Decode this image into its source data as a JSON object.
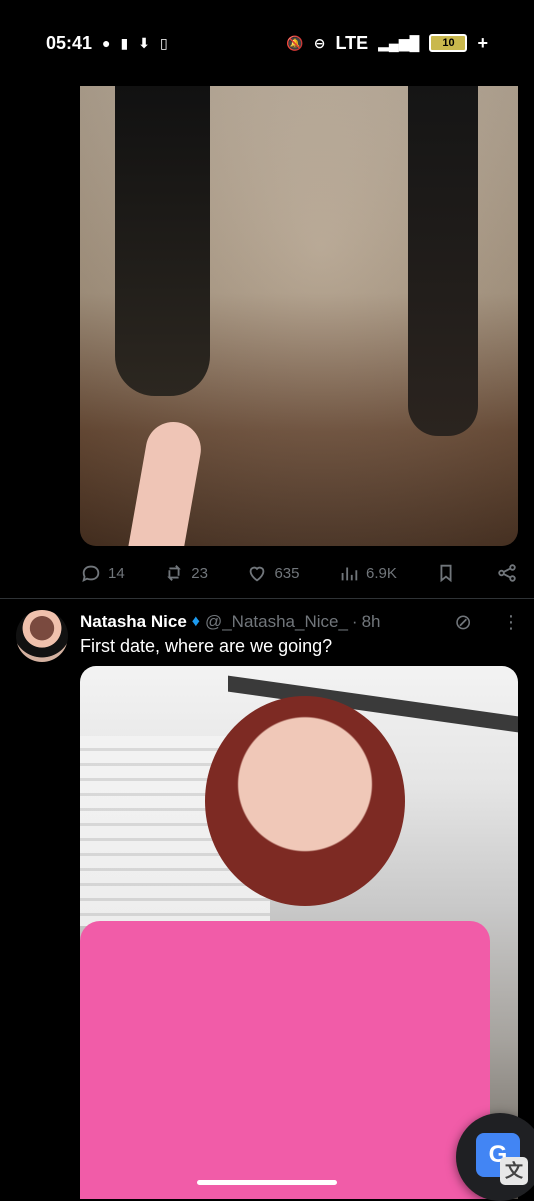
{
  "status_bar": {
    "time": "05:41",
    "network": "LTE",
    "battery": "10",
    "battery_suffix": "+"
  },
  "first_post": {
    "actions": {
      "replies": "14",
      "reposts": "23",
      "likes": "635",
      "views": "6.9K"
    }
  },
  "second_post": {
    "author_name": "Natasha Nice",
    "handle": "@_Natasha_Nice_",
    "separator": "·",
    "time": "8h",
    "text": "First date, where are we going?"
  },
  "icons": {
    "reply": "reply-icon",
    "repost": "repost-icon",
    "like": "like-icon",
    "views": "views-icon",
    "bookmark": "bookmark-icon",
    "share": "share-icon",
    "verified": "verified-icon",
    "grok": "grok-icon",
    "more": "more-icon",
    "translate": "translate-icon"
  },
  "colors": {
    "background": "#000000",
    "primary_text": "#e7e9ea",
    "secondary_text": "#71767b",
    "verified": "#1d9bf0",
    "translate_blue": "#4285f4"
  }
}
